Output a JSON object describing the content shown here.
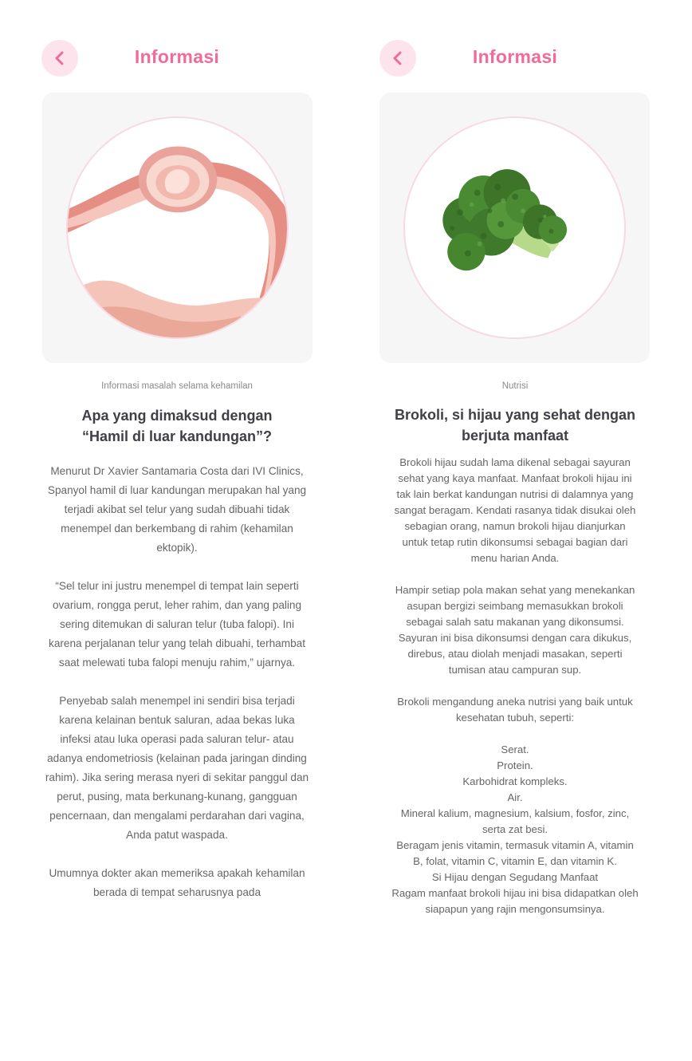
{
  "screens": [
    {
      "header": {
        "title": "Informasi",
        "back_icon": "chevron-left-icon"
      },
      "image": {
        "subject": "ectopic-pregnancy-illustration"
      },
      "category": "Informasi masalah selama kehamilan",
      "heading": "Apa yang dimaksud dengan\n“Hamil di luar kandungan”?",
      "body": "Menurut Dr Xavier Santamaria Costa dari IVI Clinics, Spanyol hamil di luar kandungan merupakan hal yang terjadi akibat sel telur yang sudah dibuahi tidak menempel dan berkembang di rahim (kehamilan ektopik).\n\n“Sel telur ini justru menempel di tempat lain seperti ovarium, rongga perut,  leher rahim, dan yang paling sering ditemukan di saluran telur (tuba falopi). Ini karena perjalanan telur yang telah dibuahi, terhambat saat melewati tuba falopi menuju rahim,” ujarnya.\n\nPenyebab salah menempel ini sendiri bisa terjadi karena kelainan bentuk saluran, adaa bekas luka infeksi atau  luka operasi pada saluran telur- atau adanya endometriosis (kelainan pada jaringan dinding rahim). Jika sering merasa nyeri di sekitar panggul dan perut, pusing, mata berkunang-kunang, gangguan pencernaan, dan mengalami perdarahan dari vagina, Anda patut waspada.\n\nUmumnya dokter akan memeriksa apakah kehamilan berada di tempat seharusnya pada"
    },
    {
      "header": {
        "title": "Informasi",
        "back_icon": "chevron-left-icon"
      },
      "image": {
        "subject": "broccoli-photo"
      },
      "category": "Nutrisi",
      "heading": "Brokoli, si hijau yang sehat dengan berjuta manfaat",
      "body": "Brokoli hijau sudah lama dikenal sebagai sayuran sehat yang kaya manfaat. Manfaat brokoli hijau ini tak lain berkat kandungan nutrisi di dalamnya yang sangat beragam. Kendati rasanya tidak disukai oleh sebagian orang, namun brokoli hijau dianjurkan untuk tetap rutin dikonsumsi sebagai bagian dari menu harian Anda.\n\nHampir setiap pola makan sehat yang menekankan asupan bergizi seimbang memasukkan brokoli sebagai salah satu makanan yang dikonsumsi. Sayuran ini bisa dikonsumsi dengan cara dikukus, direbus, atau diolah menjadi masakan, seperti tumisan atau campuran sup.\n\nBrokoli mengandung aneka nutrisi yang baik untuk kesehatan tubuh, seperti:\n\nSerat.\nProtein.\nKarbohidrat kompleks.\nAir.\nMineral kalium, magnesium, kalsium, fosfor, zinc, serta zat besi.\nBeragam jenis vitamin, termasuk vitamin A, vitamin B, folat, vitamin C, vitamin E, dan vitamin K.\nSi Hijau dengan Segudang Manfaat\nRagam manfaat brokoli hijau ini bisa didapatkan oleh siapapun yang rajin mengonsumsinya."
    }
  ],
  "colors": {
    "accent": "#f06b9a",
    "accent_soft": "#fde4ec",
    "card_bg": "#f6f6f6",
    "heading": "#3f3f46",
    "text": "#666666"
  }
}
